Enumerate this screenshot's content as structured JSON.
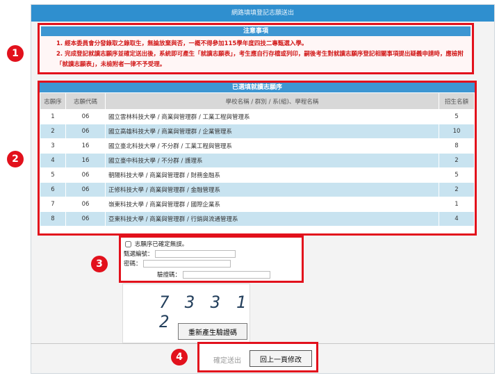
{
  "page": {
    "title": "網路填填登記志願送出"
  },
  "notice": {
    "header": "注意事項",
    "items": [
      "1. 經本委員會分發錄取之錄取生，無論放棄與否，一概不得參加115學年度四技二專甄選入學。",
      "2. 完成登記就讀志願序並確定送出後，系統即可產生「就讀志願表」，考生應自行存檔或列印，嗣後考生對就讀志願序登記相關事項提出疑義申請時，應檢附「就讀志願表」，未檢附者一律不予受理。"
    ]
  },
  "choices": {
    "header": "已選填就讀志願序",
    "columns": [
      "志願序",
      "志願代碼",
      "學校名稱 / 群別 / 系(組)、學程名稱",
      "招生名額"
    ],
    "rows": [
      {
        "order": "1",
        "code": "06",
        "name": "國立雲林科技大學 / 商業與管理群 / 工業工程與管理系",
        "quota": "5"
      },
      {
        "order": "2",
        "code": "06",
        "name": "國立高雄科技大學 / 商業與管理群 / 企業管理系",
        "quota": "10"
      },
      {
        "order": "3",
        "code": "16",
        "name": "國立臺北科技大學 / 不分群 / 工業工程與管理系",
        "quota": "8"
      },
      {
        "order": "4",
        "code": "16",
        "name": "國立臺中科技大學 / 不分群 / 護理系",
        "quota": "2"
      },
      {
        "order": "5",
        "code": "06",
        "name": "朝陽科技大學 / 商業與管理群 / 財務金融系",
        "quota": "5"
      },
      {
        "order": "6",
        "code": "06",
        "name": "正修科技大學 / 商業與管理群 / 金融管理系",
        "quota": "2"
      },
      {
        "order": "7",
        "code": "06",
        "name": "嶺東科技大學 / 商業與管理群 / 國際企業系",
        "quota": "1"
      },
      {
        "order": "8",
        "code": "06",
        "name": "亞東科技大學 / 商業與管理群 / 行銷與流通管理系",
        "quota": "4"
      }
    ]
  },
  "form": {
    "confirm_label": "志願序已確定無誤。",
    "account_label": "甄選編號：",
    "password_label": "密碼：",
    "captcha_label": "驗證碼："
  },
  "captcha": {
    "code": "7 3 3 1 2",
    "regenerate_label": "重新產生驗證碼"
  },
  "actions": {
    "submit_label": "確定送出",
    "back_label": "回上一頁修改"
  },
  "badges": {
    "one": "1",
    "two": "2",
    "three": "3",
    "four": "4"
  },
  "colors": {
    "highlight": "#e2111c",
    "header_blue": "#3d96d2",
    "row_alt": "#c8e3f0",
    "notice_text": "#d11717"
  }
}
